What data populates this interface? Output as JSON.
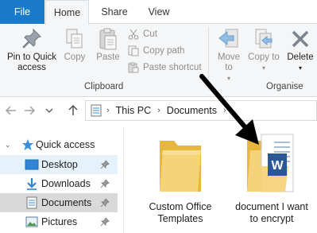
{
  "ribbon": {
    "tabs": {
      "file": "File",
      "home": "Home",
      "share": "Share",
      "view": "View"
    },
    "clipboard": {
      "pin_label": "Pin to Quick access",
      "copy_label": "Copy",
      "paste_label": "Paste",
      "cut_label": "Cut",
      "copy_path_label": "Copy path",
      "paste_shortcut_label": "Paste shortcut",
      "group_label": "Clipboard"
    },
    "organise": {
      "move_to_label": "Move to",
      "copy_to_label": "Copy to",
      "delete_label": "Delete",
      "group_label": "Organise"
    }
  },
  "address": {
    "crumbs": [
      "This PC",
      "Documents"
    ]
  },
  "navpane": {
    "items": [
      {
        "label": "Quick access",
        "icon": "star-icon"
      },
      {
        "label": "Desktop",
        "icon": "desktop-icon"
      },
      {
        "label": "Downloads",
        "icon": "download-icon"
      },
      {
        "label": "Documents",
        "icon": "documents-icon"
      },
      {
        "label": "Pictures",
        "icon": "pictures-icon"
      }
    ]
  },
  "content": {
    "items": [
      {
        "name": "Custom Office Templates",
        "line1": "Custom Office",
        "line2": "Templates",
        "icon": "folder-icon"
      },
      {
        "name": "document I want to encrypt",
        "line1": "document I want",
        "line2": "to encrypt",
        "icon": "word-document-icon"
      }
    ]
  },
  "colors": {
    "accent": "#1979ca",
    "ribbon_bg": "#f5f6f7",
    "selection": "#d9d9d9",
    "hover": "#e5f1fb",
    "folder": "#f3c756"
  }
}
